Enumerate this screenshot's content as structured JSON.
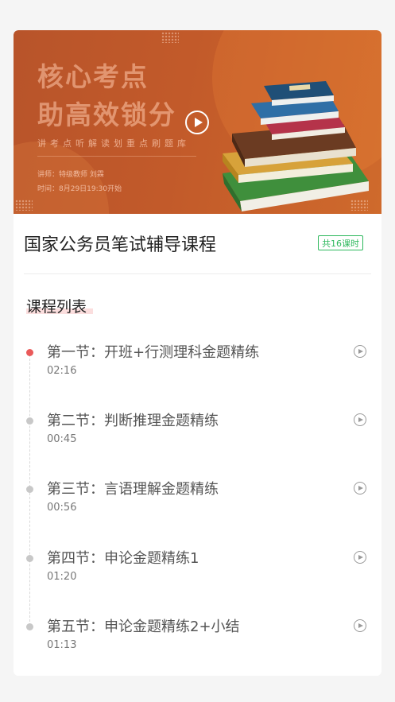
{
  "banner": {
    "headline_line1": "核心考点",
    "headline_line2": "助高效锁分",
    "subtitle": "讲考点听解读划重点刷题库",
    "lecturer": "讲师：特级教师 刘霖",
    "schedule": "时间：8月29日19:30开始",
    "play_icon": "play-circle-icon"
  },
  "course": {
    "title": "国家公务员笔试辅导课程",
    "lesson_count_badge": "共16课时"
  },
  "section": {
    "title": "课程列表"
  },
  "lessons": [
    {
      "name": "第一节：开班+行测理科金题精练",
      "duration": "02:16",
      "active": true
    },
    {
      "name": "第二节：判断推理金题精练",
      "duration": "00:45",
      "active": false
    },
    {
      "name": "第三节：言语理解金题精练",
      "duration": "00:56",
      "active": false
    },
    {
      "name": "第四节：申论金题精练1",
      "duration": "01:20",
      "active": false
    },
    {
      "name": "第五节：申论金题精练2+小结",
      "duration": "01:13",
      "active": false
    }
  ],
  "colors": {
    "accent_red": "#ea5a5a",
    "badge_green": "#2db85c",
    "banner_orange": "#c25a2a"
  }
}
